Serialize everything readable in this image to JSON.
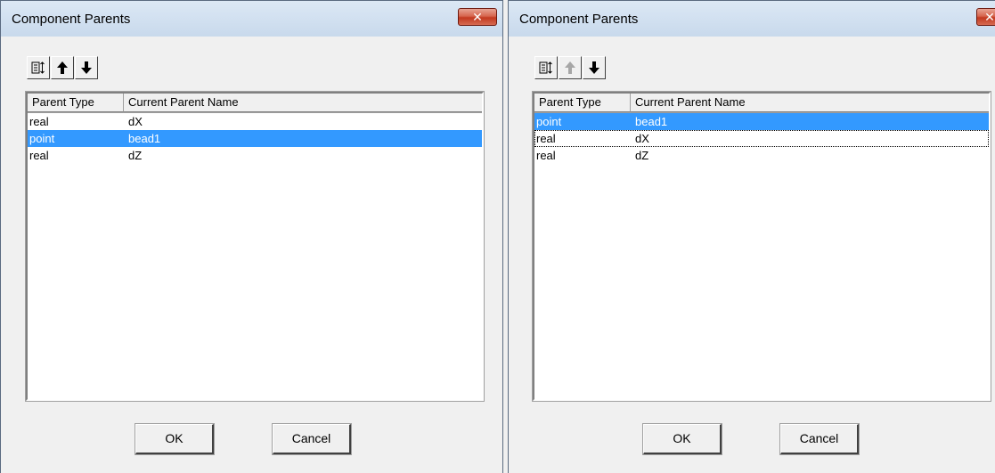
{
  "dialogs": [
    {
      "title": "Component Parents",
      "close_glyph": "✕",
      "toolbar": {
        "sort_icon": "sort-icon",
        "up_icon": "arrow-up-icon",
        "down_icon": "arrow-down-icon",
        "up_enabled": true
      },
      "columns": [
        "Parent Type",
        "Current Parent Name"
      ],
      "rows": [
        {
          "type": "real",
          "name": "dX"
        },
        {
          "type": "point",
          "name": "bead1",
          "selected": true
        },
        {
          "type": "real",
          "name": "dZ"
        }
      ],
      "ok_label": "OK",
      "cancel_label": "Cancel"
    },
    {
      "title": "Component Parents",
      "close_glyph": "✕",
      "toolbar": {
        "sort_icon": "sort-icon",
        "up_icon": "arrow-up-icon",
        "down_icon": "arrow-down-icon",
        "up_enabled": false
      },
      "columns": [
        "Parent Type",
        "Current Parent Name"
      ],
      "rows": [
        {
          "type": "point",
          "name": "bead1",
          "selected": true
        },
        {
          "type": "real",
          "name": "dX",
          "focused": true
        },
        {
          "type": "real",
          "name": "dZ"
        }
      ],
      "ok_label": "OK",
      "cancel_label": "Cancel"
    }
  ]
}
